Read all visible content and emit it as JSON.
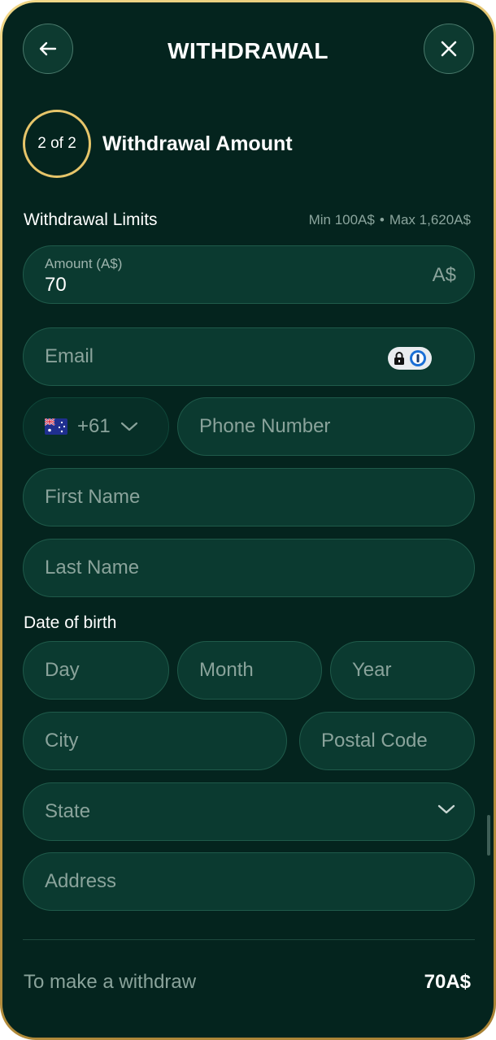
{
  "header": {
    "title": "WITHDRAWAL",
    "back_icon": "arrow-left-icon",
    "close_icon": "close-icon"
  },
  "step": {
    "indicator": "2 of 2",
    "title": "Withdrawal Amount"
  },
  "limits": {
    "label": "Withdrawal Limits",
    "min": "Min 100A$",
    "separator": "•",
    "max": "Max 1,620A$"
  },
  "form": {
    "amount": {
      "label": "Amount (A$)",
      "value": "70",
      "currency": "A$"
    },
    "email": {
      "placeholder": "Email"
    },
    "country_code": {
      "flag": "australia-flag",
      "value": "+61"
    },
    "phone": {
      "placeholder": "Phone Number"
    },
    "first_name": {
      "placeholder": "First Name"
    },
    "last_name": {
      "placeholder": "Last Name"
    },
    "dob": {
      "label": "Date of birth",
      "day_placeholder": "Day",
      "month_placeholder": "Month",
      "year_placeholder": "Year"
    },
    "city": {
      "placeholder": "City"
    },
    "postal_code": {
      "placeholder": "Postal Code"
    },
    "state": {
      "placeholder": "State"
    },
    "address": {
      "placeholder": "Address"
    }
  },
  "footer": {
    "label": "To make a withdraw",
    "amount": "70A$"
  },
  "colors": {
    "background": "#04241e",
    "field": "#0b3a30",
    "accent_gold": "#e6c56a",
    "text_muted": "#8aa39b"
  }
}
